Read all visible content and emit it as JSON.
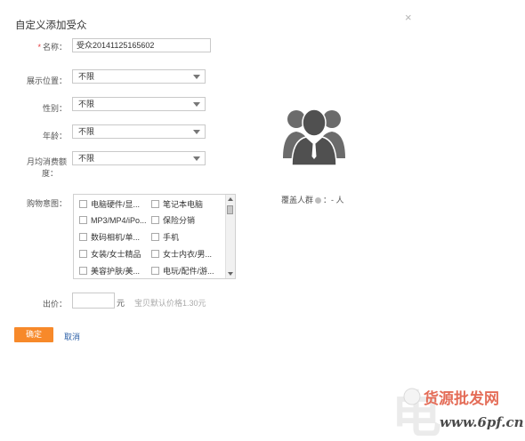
{
  "dialog": {
    "title": "自定义添加受众",
    "close_glyph": "×"
  },
  "form": {
    "name": {
      "label": "名称：",
      "required_mark": "*",
      "value": "受众20141125165602"
    },
    "position": {
      "label": "展示位置：",
      "value": "不限"
    },
    "gender": {
      "label": "性别：",
      "value": "不限"
    },
    "age": {
      "label": "年龄：",
      "value": "不限"
    },
    "spend": {
      "label_line1": "月均消费额",
      "label_line2": "度：",
      "value": "不限"
    },
    "intent": {
      "label": "购物意图：",
      "options": [
        "电脑硬件/显...",
        "笔记本电脑",
        "MP3/MP4/iPo...",
        "保险分销",
        "数码相机/单...",
        "手机",
        "女装/女士精品",
        "女士内衣/男...",
        "美容护肤/美...",
        "电玩/配件/游..."
      ]
    },
    "bid": {
      "label": "出价：",
      "value": "",
      "unit": "元",
      "hint": "宝贝默认价格1.30元"
    }
  },
  "buttons": {
    "confirm": "确定",
    "cancel": "取消"
  },
  "coverage": {
    "label": "覆盖人群",
    "separator": "：",
    "value": "- 人"
  },
  "watermark": {
    "line1": "货源批发网",
    "line2": "www.6pf.cn"
  },
  "colors": {
    "confirm_bg": "#f7892a",
    "required": "#e4393c",
    "link": "#2b5fa6",
    "avatar": "#5a5a5a"
  }
}
